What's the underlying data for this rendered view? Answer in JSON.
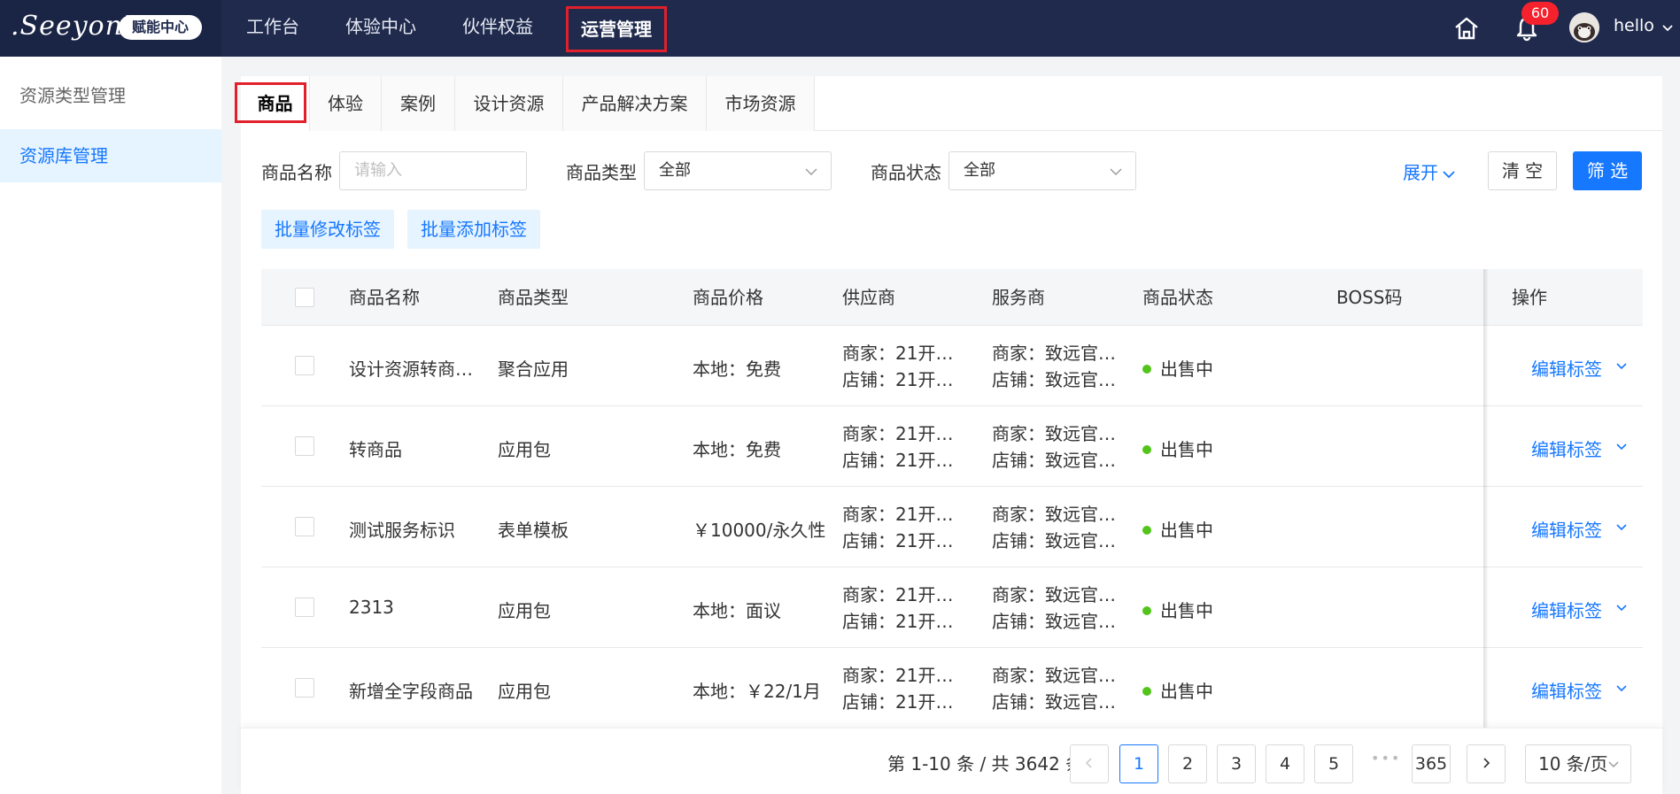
{
  "brand": {
    "logo_text": ".Seeyon™",
    "badge": "赋能中心"
  },
  "topnav": {
    "items": [
      {
        "label": "工作台"
      },
      {
        "label": "体验中心"
      },
      {
        "label": "伙伴权益"
      },
      {
        "label": "运营管理"
      }
    ],
    "active_index": 3,
    "notification_count": "60",
    "username": "hello"
  },
  "sidebar": {
    "items": [
      {
        "label": "资源类型管理"
      },
      {
        "label": "资源库管理"
      }
    ],
    "active_index": 1
  },
  "tabs": {
    "items": [
      "商品",
      "体验",
      "案例",
      "设计资源",
      "产品解决方案",
      "市场资源"
    ],
    "active_index": 0
  },
  "filters": {
    "name_label": "商品名称",
    "name_placeholder": "请输入",
    "type_label": "商品类型",
    "type_value": "全部",
    "status_label": "商品状态",
    "status_value": "全部",
    "expand_label": "展开",
    "clear_label": "清 空",
    "filter_label": "筛 选"
  },
  "actions": {
    "batch_edit": "批量修改标签",
    "batch_add": "批量添加标签"
  },
  "table": {
    "columns": [
      "商品名称",
      "商品类型",
      "商品价格",
      "供应商",
      "服务商",
      "商品状态",
      "BOSS码",
      "操作"
    ],
    "rows": [
      {
        "name": "设计资源转商…",
        "type": "聚合应用",
        "price": "本地：免费",
        "supplier1": "商家：21开…",
        "supplier2": "店铺：21开…",
        "provider1": "商家：致远官…",
        "provider2": "店铺：致远官…",
        "status": "出售中",
        "boss": "",
        "op": "编辑标签"
      },
      {
        "name": "转商品",
        "type": "应用包",
        "price": "本地：免费",
        "supplier1": "商家：21开…",
        "supplier2": "店铺：21开…",
        "provider1": "商家：致远官…",
        "provider2": "店铺：致远官…",
        "status": "出售中",
        "boss": "",
        "op": "编辑标签"
      },
      {
        "name": "测试服务标识",
        "type": "表单模板",
        "price": "￥10000/永久性",
        "supplier1": "商家：21开…",
        "supplier2": "店铺：21开…",
        "provider1": "商家：致远官…",
        "provider2": "店铺：致远官…",
        "status": "出售中",
        "boss": "",
        "op": "编辑标签"
      },
      {
        "name": "2313",
        "type": "应用包",
        "price": "本地：面议",
        "supplier1": "商家：21开…",
        "supplier2": "店铺：21开…",
        "provider1": "商家：致远官…",
        "provider2": "店铺：致远官…",
        "status": "出售中",
        "boss": "",
        "op": "编辑标签"
      },
      {
        "name": "新增全字段商品",
        "type": "应用包",
        "price": "本地：￥22/1月",
        "supplier1": "商家：21开…",
        "supplier2": "店铺：21开…",
        "provider1": "商家：致远官…",
        "provider2": "店铺：致远官…",
        "status": "出售中",
        "boss": "",
        "op": "编辑标签"
      }
    ]
  },
  "pagination": {
    "summary": "第 1-10 条 / 共 3642 条",
    "pages": [
      "1",
      "2",
      "3",
      "4",
      "5"
    ],
    "ellipsis": "•••",
    "last_page": "365",
    "current": "1",
    "page_size": "10 条/页"
  },
  "colors": {
    "topbar": "#1f2a4d",
    "primary": "#1677ff",
    "highlight": "#e0202a",
    "status_ok": "#52c41a"
  }
}
